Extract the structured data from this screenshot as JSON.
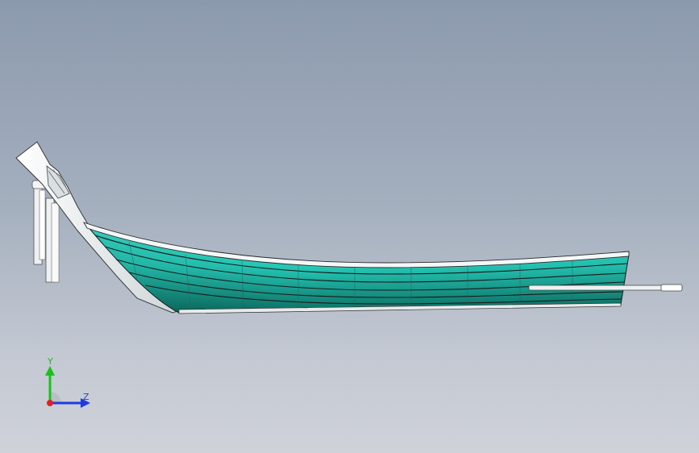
{
  "viewport": {
    "background_top": "#8c9aae",
    "background_bottom": "#cfd2d9"
  },
  "model": {
    "hull_color_light": "#35e3cf",
    "hull_color_dark": "#0f7a6d",
    "edge_color": "#222222",
    "trim_color": "#f2f4f4",
    "shaft_color": "#e8ecee"
  },
  "triad": {
    "y_label": "Y",
    "z_label": "Z",
    "y_color": "#19c21b",
    "z_color": "#1d3ce0",
    "origin_color": "#e02020"
  }
}
